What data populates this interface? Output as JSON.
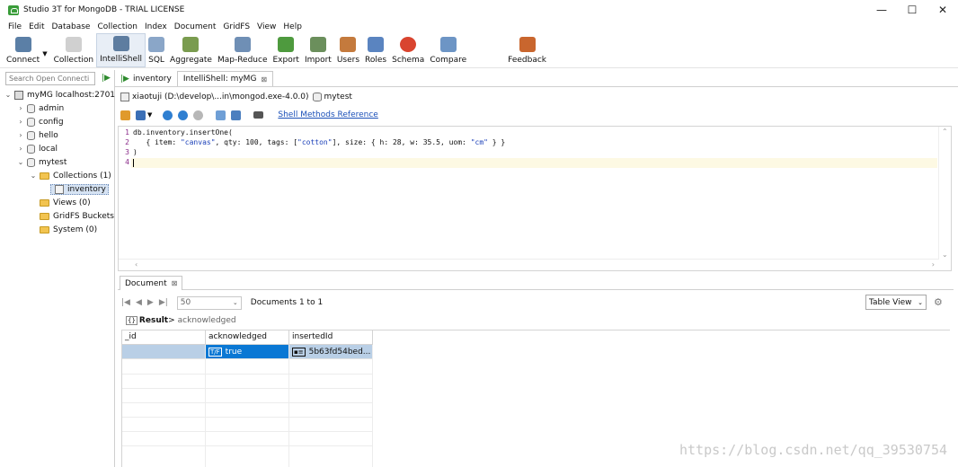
{
  "window": {
    "title": "Studio 3T for MongoDB - TRIAL LICENSE",
    "controls": {
      "minimize": "—",
      "maximize": "☐",
      "close": "✕"
    }
  },
  "menu": [
    "File",
    "Edit",
    "Database",
    "Collection",
    "Index",
    "Document",
    "GridFS",
    "View",
    "Help"
  ],
  "toolbar": [
    {
      "label": "Connect",
      "icon": "connect-icon",
      "color": "#5b7fa6"
    },
    {
      "label": "Collection",
      "icon": "collection-icon",
      "color": "#b8b8b8"
    },
    {
      "label": "IntelliShell",
      "icon": "intellishell-icon",
      "color": "#5e7da0",
      "active": true
    },
    {
      "label": "SQL",
      "icon": "sql-icon",
      "color": "#8aa6c8"
    },
    {
      "label": "Aggregate",
      "icon": "aggregate-icon",
      "color": "#7a9c4f"
    },
    {
      "label": "Map-Reduce",
      "icon": "map-reduce-icon",
      "color": "#6f8fb5"
    },
    {
      "label": "Export",
      "icon": "export-icon",
      "color": "#4e9a3e"
    },
    {
      "label": "Import",
      "icon": "import-icon",
      "color": "#6b8f5c"
    },
    {
      "label": "Users",
      "icon": "users-icon",
      "color": "#c47a3d"
    },
    {
      "label": "Roles",
      "icon": "roles-icon",
      "color": "#5a84c0"
    },
    {
      "label": "Schema",
      "icon": "schema-icon",
      "color": "#d9442f"
    },
    {
      "label": "Compare",
      "icon": "compare-icon",
      "color": "#6d95c5"
    },
    {
      "label": "Feedback",
      "icon": "feedback-icon",
      "color": "#c9662e"
    }
  ],
  "sidebar": {
    "search_placeholder": "Search Open Connecti",
    "tree": {
      "server": "myMG localhost:2701",
      "databases": [
        "admin",
        "config",
        "hello",
        "local",
        "mytest"
      ],
      "mytest_children": [
        "Collections (1)",
        "Views (0)",
        "GridFS Buckets",
        "System (0)"
      ],
      "collection": "inventory"
    }
  },
  "tabs": [
    {
      "label": "inventory"
    },
    {
      "label": "IntelliShell: myMG",
      "close": "⊠"
    }
  ],
  "connection": {
    "path": "xiaotuji (D:\\develop\\...in\\mongod.exe-4.0.0)",
    "database": "mytest"
  },
  "shell": {
    "methods_link": "Shell Methods Reference",
    "code": {
      "line1": "db.inventory.insertOne(",
      "line2_pre": "   { item: ",
      "line2_s1": "\"canvas\"",
      "line2_mid1": ", qty: 100, tags: [",
      "line2_s2": "\"cotton\"",
      "line2_mid2": "], size: { h: 28, w: 35.5, uom: ",
      "line2_s3": "\"cm\"",
      "line2_post": " } }",
      "line3": ")",
      "line4": ""
    },
    "line_numbers": [
      "1",
      "2",
      "3",
      "4"
    ]
  },
  "results": {
    "tab_label": "Document",
    "tab_close": "⊠",
    "page_size": "50",
    "doc_count": "Documents 1 to 1",
    "view_mode": "Table View",
    "result_label": "Result",
    "result_arrow": ">",
    "result_value": "acknowledged",
    "columns": [
      "_id",
      "acknowledged",
      "insertedId"
    ],
    "row": {
      "_id": "",
      "acknowledged": "true",
      "insertedId": "5b63fd54bed..."
    }
  },
  "watermark": "https://blog.csdn.net/qq_39530754"
}
